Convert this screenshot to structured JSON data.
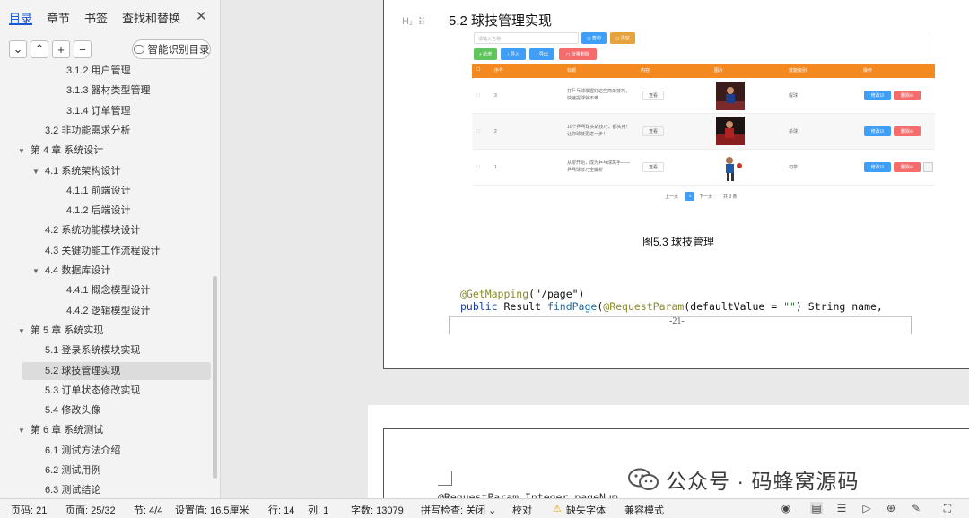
{
  "sidebar": {
    "tabs": [
      "目录",
      "章节",
      "书签",
      "查找和替换"
    ],
    "close_glyph": "✕",
    "controls": [
      "⌄",
      "⌃",
      "+",
      "−"
    ],
    "smart_button": "智能识别目录",
    "toc": [
      {
        "label": "3.1.2  用户管理",
        "level": 3
      },
      {
        "label": "3.1.3   器材类型管理",
        "level": 3
      },
      {
        "label": "3.1.4   订单管理",
        "level": 3
      },
      {
        "label": "3.2   非功能需求分析",
        "level": 2
      },
      {
        "label": "第 4 章  系统设计",
        "level": 1,
        "arrow": "▼"
      },
      {
        "label": "4.1   系统架构设计",
        "level": 2,
        "arrow": "▼"
      },
      {
        "label": "4.1.1   前端设计",
        "level": 3
      },
      {
        "label": "4.1.2   后端设计",
        "level": 3
      },
      {
        "label": "4.2   系统功能模块设计",
        "level": 2
      },
      {
        "label": "4.3   关键功能工作流程设计",
        "level": 2
      },
      {
        "label": "4.4   数据库设计",
        "level": 2,
        "arrow": "▼"
      },
      {
        "label": "4.4.1   概念模型设计",
        "level": 3
      },
      {
        "label": "4.4.2   逻辑模型设计",
        "level": 3
      },
      {
        "label": "第 5 章  系统实现",
        "level": 1,
        "arrow": "▼"
      },
      {
        "label": "5.1   登录系统模块实现",
        "level": 2
      },
      {
        "label": "5.2   球技管理实现",
        "level": 2,
        "selected": true
      },
      {
        "label": "5.3   订单状态修改实现",
        "level": 2
      },
      {
        "label": "5.4   修改头像",
        "level": 2
      },
      {
        "label": "第 6 章  系统测试",
        "level": 1,
        "arrow": "▼"
      },
      {
        "label": "6.1   测试方法介绍",
        "level": 2
      },
      {
        "label": "6.2   测试用例",
        "level": 2
      },
      {
        "label": "6.3   测试结论",
        "level": 2
      }
    ]
  },
  "document": {
    "h2_icon": "H₂",
    "heading": "5.2    球技管理实现",
    "caption": "图5.3  球技管理",
    "code_line1_ann": "@GetMapping",
    "code_line1_rest": "(\"/page\")",
    "code_line2_kw": "public",
    "code_line2_type": " Result ",
    "code_line2_fn": "findPage",
    "code_line2_paren": "(",
    "code_line2_ann": "@RequestParam",
    "code_line2_mid": "(defaultValue = ",
    "code_line2_str": "\"\"",
    "code_line2_end": ") String name,",
    "page_number": "-21-",
    "code_page2": "@RequestParam Integer pageNum,",
    "watermark": "公众号 · 码蜂窝源码"
  },
  "screenshot": {
    "search_placeholder": "请输入名称",
    "query_btn": "◻ 查询",
    "clear_btn": "◻ 清空",
    "add_btn": "+ 新增",
    "import_btn": "↓ 导入",
    "export_btn": "↑ 导出",
    "batch_delete_btn": "◻ 批量删除",
    "headers": [
      "",
      "序号",
      "标题",
      "内容",
      "图片",
      "技能级别",
      "操作"
    ],
    "rows": [
      {
        "id": "3",
        "title": "打乒乓球掌握好这些简单技巧，快速提球就不难",
        "view": "查看",
        "level": "提球",
        "edit": "修改☑",
        "del": "删除⊖"
      },
      {
        "id": "2",
        "title": "10个乒乓球实战技巧，都实用！让你球技更进一步！",
        "view": "查看",
        "level": "杀球",
        "edit": "修改☑",
        "del": "删除⊖"
      },
      {
        "id": "1",
        "title": "从零开始，成为乒乓球高手——乒乓球技巧全解析",
        "view": "查看",
        "level": "初学",
        "edit": "修改☑",
        "del": "删除⊖"
      }
    ],
    "pager": {
      "prev": "上一页",
      "current": "1",
      "next": "下一页",
      "total": "共 3 条"
    },
    "colors": {
      "header": "#f4891f",
      "blue": "#3f9ef5",
      "red": "#f56c6c",
      "green": "#5ec45b",
      "orange": "#e6a23c"
    }
  },
  "status": {
    "page": "页码: 21",
    "pages": "页面: 25/32",
    "section": "节: 4/4",
    "setting": "设置值: 16.5厘米",
    "row": "行: 14",
    "col": "列: 1",
    "words": "字数: 13079",
    "spell": "拼写检查: 关闭 ⌄",
    "proof": "校对",
    "missing_font": "缺失字体",
    "compat": "兼容模式"
  }
}
